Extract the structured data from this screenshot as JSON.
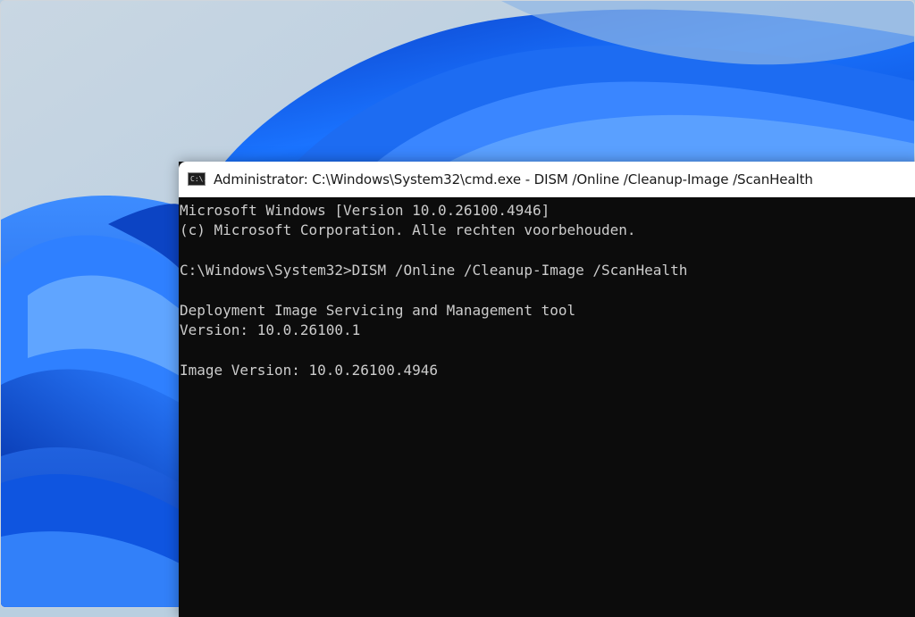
{
  "window": {
    "title": "Administrator: C:\\Windows\\System32\\cmd.exe - DISM  /Online /Cleanup-Image /ScanHealth",
    "icon": "cmd-icon",
    "icon_text": "C:\\."
  },
  "console": {
    "lines": [
      "Microsoft Windows [Version 10.0.26100.4946]",
      "(c) Microsoft Corporation. Alle rechten voorbehouden.",
      "",
      "C:\\Windows\\System32>DISM /Online /Cleanup-Image /ScanHealth",
      "",
      "Deployment Image Servicing and Management tool",
      "Version: 10.0.26100.1",
      "",
      "Image Version: 10.0.26100.4946"
    ]
  },
  "colors": {
    "console_background": "#0c0c0c",
    "console_text": "#cccccc",
    "title_bar": "#ffffff",
    "wallpaper_accent": "#1565e8"
  }
}
